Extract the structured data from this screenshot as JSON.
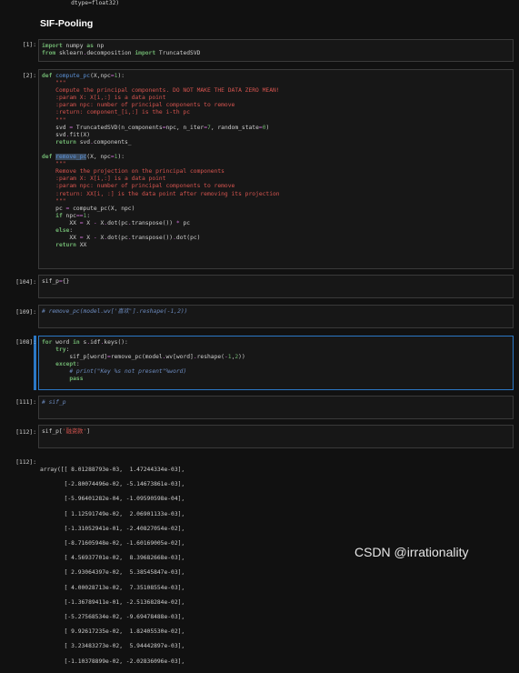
{
  "top_output": "         dtype=float32)",
  "heading": "SIF-Pooling",
  "cells": [
    {
      "prompt": "[1]:",
      "lines": [
        "import numpy as np",
        "from sklearn.decomposition import TruncatedSVD"
      ]
    },
    {
      "prompt": "[2]:",
      "lines": [
        "def compute_pc(X,npc=1):",
        "    \"\"\"",
        "    Compute the principal components. DO NOT MAKE THE DATA ZERO MEAN!",
        "    :param X: X[i,:] is a data point",
        "    :param npc: number of principal components to remove",
        "    :return: component_[i,:] is the i-th pc",
        "    \"\"\"",
        "    svd = TruncatedSVD(n_components=npc, n_iter=7, random_state=0)",
        "    svd.fit(X)",
        "    return svd.components_",
        "",
        "def remove_pc(X, npc=1):",
        "    \"\"\"",
        "    Remove the projection on the principal components",
        "    :param X: X[i,:] is a data point",
        "    :param npc: number of principal components to remove",
        "    :return: XX[i, :] is the data point after removing its projection",
        "    \"\"\"",
        "    pc = compute_pc(X, npc)",
        "    if npc==1:",
        "        XX = X - X.dot(pc.transpose()) * pc",
        "    else:",
        "        XX = X - X.dot(pc.transpose()).dot(pc)",
        "    return XX"
      ]
    },
    {
      "prompt": "[104]:",
      "lines": [
        "sif_p={}"
      ]
    },
    {
      "prompt": "[109]:",
      "lines": [
        "# remove_pc(model.wv['喜欢'].reshape(-1,2))"
      ]
    },
    {
      "prompt": "[108]:",
      "lines": [
        "for word in s.idf.keys():",
        "    try:",
        "        sif_p[word]=remove_pc(model.wv[word].reshape(-1,2))",
        "    except:",
        "        # print(\"Key %s not present\"%word)",
        "        pass"
      ]
    },
    {
      "prompt": "[111]:",
      "lines": [
        "# sif_p"
      ]
    },
    {
      "prompt": "[112]:",
      "lines": [
        "sif_p['融资款']"
      ]
    }
  ],
  "output_prompt": "[112]:",
  "output_lines": [
    "array([[ 8.01288793e-03,  1.47244334e-03],",
    "       [-2.80074496e-02, -5.14673861e-03],",
    "       [-5.96401282e-04, -1.09590598e-04],",
    "       [ 1.12591749e-02,  2.06901133e-03],",
    "       [-1.31052941e-01, -2.40827054e-02],",
    "       [-8.71605948e-02, -1.60169005e-02],",
    "       [ 4.56937701e-02,  8.39682668e-03],",
    "       [ 2.93064397e-02,  5.38545847e-03],",
    "       [ 4.00028713e-02,  7.35108554e-03],",
    "       [-1.36789411e-01, -2.51368284e-02],",
    "       [-5.27568534e-02, -9.69478488e-03],",
    "       [ 9.92617235e-02,  1.82405530e-02],",
    "       [ 3.23483273e-02,  5.94442897e-03],",
    "       [-1.10378899e-02, -2.02836096e-03],"
  ],
  "watermark": "CSDN @irrationality"
}
